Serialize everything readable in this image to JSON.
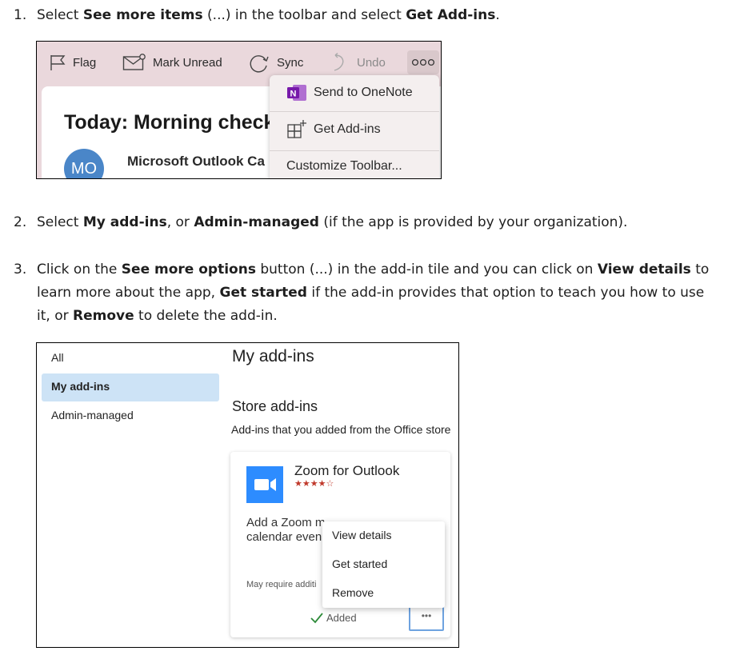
{
  "steps": [
    {
      "num": "1.",
      "parts": [
        "Select ",
        "See more items",
        " (...) in the toolbar and select ",
        "Get Add-ins",
        "."
      ]
    },
    {
      "num": "2.",
      "parts": [
        "Select ",
        "My add-ins",
        ", or ",
        "Admin-managed",
        " (if the app is provided by your organization)."
      ]
    },
    {
      "num": "3.",
      "parts": [
        "Click on the ",
        "See more options",
        " button (...) in the add-in tile and you can click on ",
        "View details",
        " to learn more about the app, ",
        "Get started",
        " if the add-in provides that option to teach you how to use it, or ",
        "Remove",
        " to delete the add-in."
      ]
    }
  ],
  "outlook": {
    "toolbar": {
      "flag": "Flag",
      "mark_unread": "Mark Unread",
      "sync": "Sync",
      "undo": "Undo"
    },
    "email": {
      "subject": "Today: Morning check",
      "avatar": "MO",
      "sender": "Microsoft Outlook Ca"
    },
    "menu": {
      "send_onenote": "Send to OneNote",
      "get_addins": "Get Add-ins",
      "customize": "Customize Toolbar..."
    },
    "colors": {
      "toolbar_bg": "#ead8dc",
      "onenote": "#7719aa",
      "avatar": "#4a86c8"
    }
  },
  "addins": {
    "nav": {
      "all": "All",
      "my_addins": "My add-ins",
      "admin_managed": "Admin-managed"
    },
    "heading": "My add-ins",
    "store_heading": "Store add-ins",
    "store_desc": "Add-ins that you added from the Office store",
    "tile": {
      "name": "Zoom for Outlook",
      "stars": "★★★★☆",
      "rating": 4,
      "desc_line1": "Add a Zoom m",
      "desc_line2": "calendar even",
      "requirement": "May require additi",
      "added": "Added",
      "more_button": "•••"
    },
    "menu": {
      "view_details": "View details",
      "get_started": "Get started",
      "remove": "Remove"
    },
    "colors": {
      "zoom": "#2d8cff",
      "selected": "#cde3f6",
      "added_check": "#2e8b3a"
    }
  }
}
